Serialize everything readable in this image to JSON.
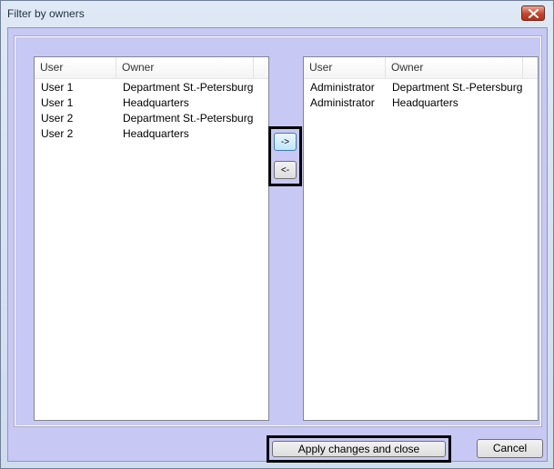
{
  "window": {
    "title": "Filter by owners",
    "close_icon": "close-x-icon"
  },
  "left_list": {
    "columns": {
      "user": "User",
      "owner": "Owner"
    },
    "rows": [
      {
        "user": "User 1",
        "owner": "Department St.-Petersburg"
      },
      {
        "user": "User 1",
        "owner": "Headquarters"
      },
      {
        "user": "User 2",
        "owner": "Department St.-Petersburg"
      },
      {
        "user": "User 2",
        "owner": "Headquarters"
      }
    ]
  },
  "right_list": {
    "columns": {
      "user": "User",
      "owner": "Owner"
    },
    "rows": [
      {
        "user": "Administrator",
        "owner": "Department St.-Petersburg"
      },
      {
        "user": "Administrator",
        "owner": "Headquarters"
      }
    ]
  },
  "transfer": {
    "move_right_label": "->",
    "move_left_label": "<-"
  },
  "footer": {
    "apply_label": "Apply changes and close",
    "cancel_label": "Cancel"
  }
}
